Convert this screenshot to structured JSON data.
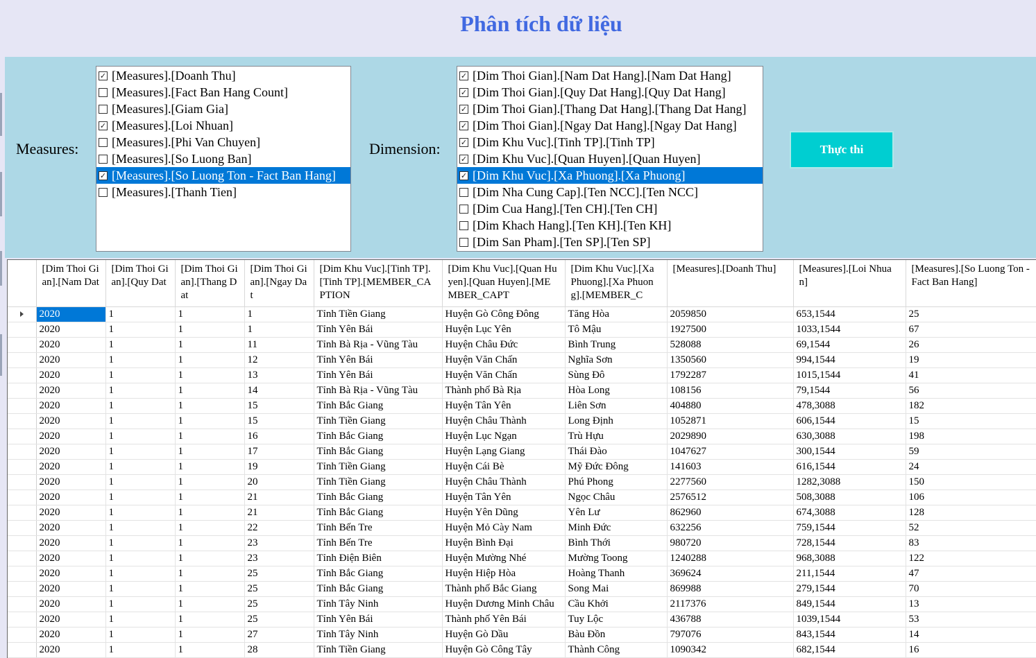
{
  "title": "Phân tích dữ liệu",
  "measures_label": "Measures:",
  "dimension_label": "Dimension:",
  "run_button": "Thực thi",
  "measures": [
    {
      "label": "[Measures].[Doanh Thu]",
      "checked": true,
      "selected": false
    },
    {
      "label": "[Measures].[Fact Ban Hang Count]",
      "checked": false,
      "selected": false
    },
    {
      "label": "[Measures].[Giam Gia]",
      "checked": false,
      "selected": false
    },
    {
      "label": "[Measures].[Loi Nhuan]",
      "checked": true,
      "selected": false
    },
    {
      "label": "[Measures].[Phi Van Chuyen]",
      "checked": false,
      "selected": false
    },
    {
      "label": "[Measures].[So Luong Ban]",
      "checked": false,
      "selected": false
    },
    {
      "label": "[Measures].[So Luong Ton - Fact Ban Hang]",
      "checked": true,
      "selected": true
    },
    {
      "label": "[Measures].[Thanh Tien]",
      "checked": false,
      "selected": false
    }
  ],
  "dimensions": [
    {
      "label": "[Dim Thoi Gian].[Nam Dat Hang].[Nam Dat Hang]",
      "checked": true,
      "selected": false
    },
    {
      "label": "[Dim Thoi Gian].[Quy Dat Hang].[Quy Dat Hang]",
      "checked": true,
      "selected": false
    },
    {
      "label": "[Dim Thoi Gian].[Thang Dat Hang].[Thang Dat Hang]",
      "checked": true,
      "selected": false
    },
    {
      "label": "[Dim Thoi Gian].[Ngay Dat Hang].[Ngay Dat Hang]",
      "checked": true,
      "selected": false
    },
    {
      "label": "[Dim Khu Vuc].[Tinh TP].[Tinh TP]",
      "checked": true,
      "selected": false
    },
    {
      "label": "[Dim Khu Vuc].[Quan Huyen].[Quan Huyen]",
      "checked": true,
      "selected": false
    },
    {
      "label": "[Dim Khu Vuc].[Xa Phuong].[Xa Phuong]",
      "checked": true,
      "selected": true
    },
    {
      "label": "[Dim Nha Cung Cap].[Ten NCC].[Ten NCC]",
      "checked": false,
      "selected": false
    },
    {
      "label": "[Dim Cua Hang].[Ten CH].[Ten CH]",
      "checked": false,
      "selected": false
    },
    {
      "label": "[Dim Khach Hang].[Ten KH].[Ten KH]",
      "checked": false,
      "selected": false
    },
    {
      "label": "[Dim San Pham].[Ten SP].[Ten SP]",
      "checked": false,
      "selected": false
    }
  ],
  "grid": {
    "columns": [
      "[Dim Thoi Gian].[Nam Dat",
      "[Dim Thoi Gian].[Quy Dat",
      "[Dim Thoi Gian].[Thang Dat",
      "[Dim Thoi Gian].[Ngay Dat",
      "[Dim Khu Vuc].[Tinh TP].[Tinh TP].[MEMBER_CAPTION",
      "[Dim Khu Vuc].[Quan Huyen].[Quan Huyen].[MEMBER_CAPT",
      "[Dim Khu Vuc].[Xa Phuong].[Xa Phuong].[MEMBER_C",
      "[Measures].[Doanh Thu]",
      "[Measures].[Loi Nhuan]",
      "[Measures].[So Luong Ton - Fact Ban Hang]"
    ],
    "rows": [
      [
        "2020",
        "1",
        "1",
        "1",
        "Tỉnh Tiền Giang",
        "Huyện Gò Công Đông",
        "Tăng Hòa",
        "2059850",
        "653,1544",
        "25"
      ],
      [
        "2020",
        "1",
        "1",
        "1",
        "Tỉnh Yên Bái",
        "Huyện Lục Yên",
        "Tô Mậu",
        "1927500",
        "1033,1544",
        "67"
      ],
      [
        "2020",
        "1",
        "1",
        "11",
        "Tỉnh Bà Rịa - Vũng Tàu",
        "Huyện Châu Đức",
        "Bình Trung",
        "528088",
        "69,1544",
        "26"
      ],
      [
        "2020",
        "1",
        "1",
        "12",
        "Tỉnh Yên Bái",
        "Huyện Văn Chấn",
        "Nghĩa Sơn",
        "1350560",
        "994,1544",
        "19"
      ],
      [
        "2020",
        "1",
        "1",
        "13",
        "Tỉnh Yên Bái",
        "Huyện Văn Chấn",
        "Sùng Đô",
        "1792287",
        "1015,1544",
        "41"
      ],
      [
        "2020",
        "1",
        "1",
        "14",
        "Tỉnh Bà Rịa - Vũng Tàu",
        "Thành phố Bà Rịa",
        "Hòa Long",
        "108156",
        "79,1544",
        "56"
      ],
      [
        "2020",
        "1",
        "1",
        "15",
        "Tỉnh Bắc Giang",
        "Huyện Tân Yên",
        "Liên Sơn",
        "404880",
        "478,3088",
        "182"
      ],
      [
        "2020",
        "1",
        "1",
        "15",
        "Tỉnh Tiền Giang",
        "Huyện Châu Thành",
        "Long Định",
        "1052871",
        "606,1544",
        "15"
      ],
      [
        "2020",
        "1",
        "1",
        "16",
        "Tỉnh Bắc Giang",
        "Huyện Lục Ngạn",
        "Trù Hựu",
        "2029890",
        "630,3088",
        "198"
      ],
      [
        "2020",
        "1",
        "1",
        "17",
        "Tỉnh Bắc Giang",
        "Huyện Lạng Giang",
        "Thái Đào",
        "1047627",
        "300,1544",
        "59"
      ],
      [
        "2020",
        "1",
        "1",
        "19",
        "Tỉnh Tiền Giang",
        "Huyện Cái Bè",
        "Mỹ Đức Đông",
        "141603",
        "616,1544",
        "24"
      ],
      [
        "2020",
        "1",
        "1",
        "20",
        "Tỉnh Tiền Giang",
        "Huyện Châu Thành",
        "Phú Phong",
        "2277560",
        "1282,3088",
        "150"
      ],
      [
        "2020",
        "1",
        "1",
        "21",
        "Tỉnh Bắc Giang",
        "Huyện Tân Yên",
        "Ngọc Châu",
        "2576512",
        "508,3088",
        "106"
      ],
      [
        "2020",
        "1",
        "1",
        "21",
        "Tỉnh Bắc Giang",
        "Huyện Yên Dũng",
        "Yên Lư",
        "862960",
        "674,3088",
        "128"
      ],
      [
        "2020",
        "1",
        "1",
        "22",
        "Tỉnh Bến Tre",
        "Huyện Mỏ Cày Nam",
        "Minh Đức",
        "632256",
        "759,1544",
        "52"
      ],
      [
        "2020",
        "1",
        "1",
        "23",
        "Tỉnh Bến Tre",
        "Huyện Bình Đại",
        "Bình Thới",
        "980720",
        "728,1544",
        "83"
      ],
      [
        "2020",
        "1",
        "1",
        "23",
        "Tỉnh Điện Biên",
        "Huyện Mường Nhé",
        "Mường Toong",
        "1240288",
        "968,3088",
        "122"
      ],
      [
        "2020",
        "1",
        "1",
        "25",
        "Tỉnh Bắc Giang",
        "Huyện Hiệp Hòa",
        "Hoàng Thanh",
        "369624",
        "211,1544",
        "47"
      ],
      [
        "2020",
        "1",
        "1",
        "25",
        "Tỉnh Bắc Giang",
        "Thành phố Bắc Giang",
        "Song Mai",
        "869988",
        "279,1544",
        "70"
      ],
      [
        "2020",
        "1",
        "1",
        "25",
        "Tỉnh Tây Ninh",
        "Huyện Dương Minh Châu",
        "Cầu Khởi",
        "2117376",
        "849,1544",
        "13"
      ],
      [
        "2020",
        "1",
        "1",
        "25",
        "Tỉnh Yên Bái",
        "Thành phố Yên Bái",
        "Tuy Lộc",
        "436788",
        "1039,1544",
        "53"
      ],
      [
        "2020",
        "1",
        "1",
        "27",
        "Tỉnh Tây Ninh",
        "Huyện Gò Dầu",
        "Bàu Đồn",
        "797076",
        "843,1544",
        "14"
      ],
      [
        "2020",
        "1",
        "1",
        "28",
        "Tỉnh Tiền Giang",
        "Huyện Gò Công Tây",
        "Thành Công",
        "1090342",
        "682,1544",
        "16"
      ]
    ],
    "current_row": 0
  }
}
